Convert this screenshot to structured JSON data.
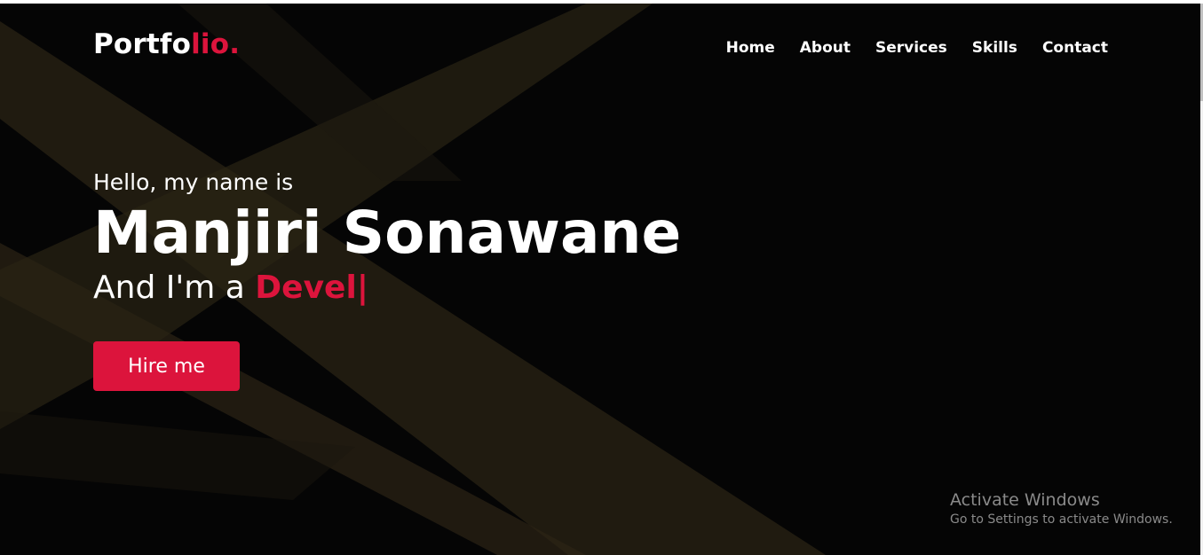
{
  "brand": {
    "logo_main": "Portfo",
    "logo_accent": "lio.",
    "accent_color": "#dc143c"
  },
  "nav": {
    "items": [
      {
        "label": "Home"
      },
      {
        "label": "About"
      },
      {
        "label": "Services"
      },
      {
        "label": "Skills"
      },
      {
        "label": "Contact"
      }
    ]
  },
  "hero": {
    "greeting": "Hello, my name is",
    "name": "Manjiri Sonawane",
    "role_prefix": "And I'm a",
    "role_typed": "Devel",
    "cursor": "|",
    "cta_label": "Hire me"
  },
  "watermark": {
    "title": "Activate Windows",
    "subtitle": "Go to Settings to activate Windows."
  }
}
